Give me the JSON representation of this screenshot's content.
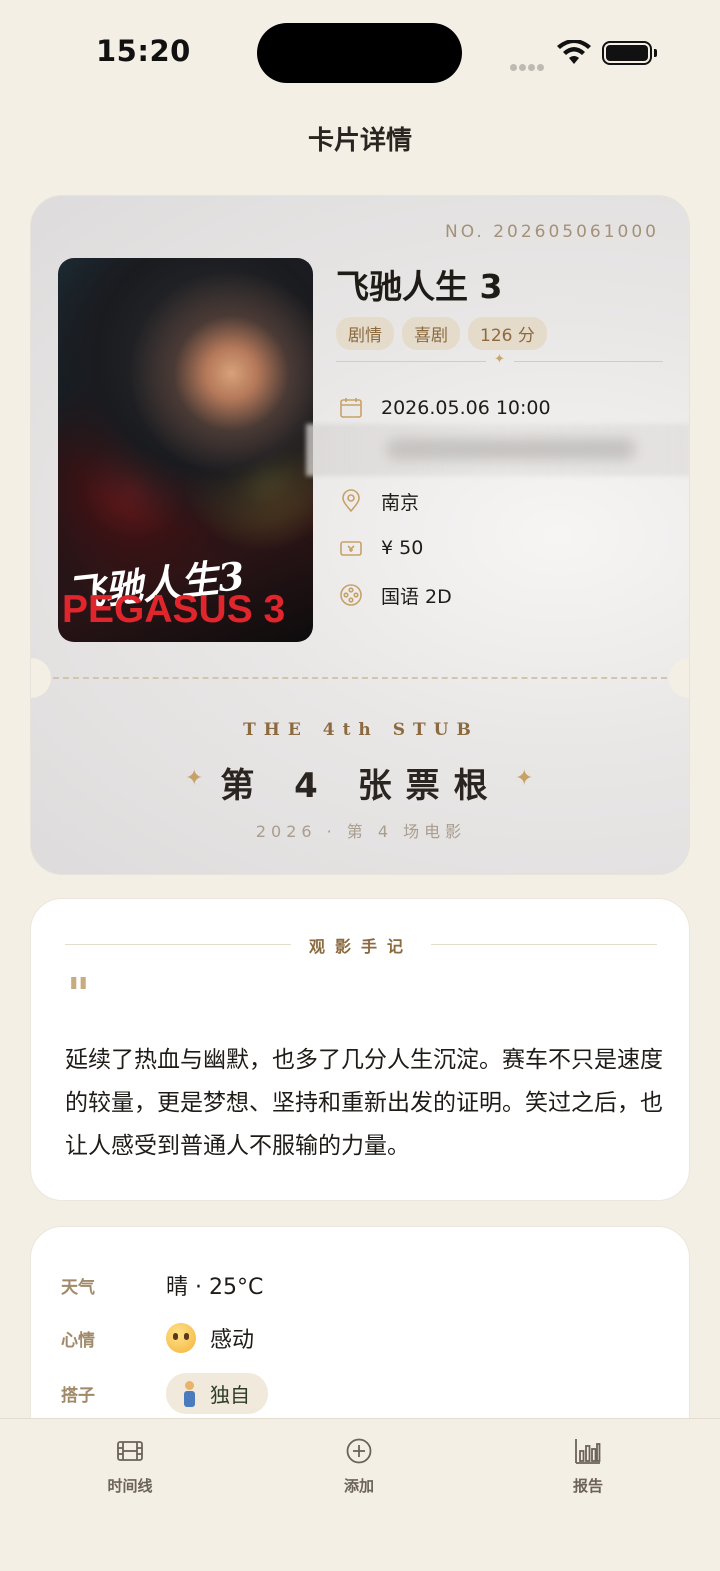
{
  "status_bar": {
    "time": "15:20"
  },
  "nav": {
    "title": "卡片详情"
  },
  "ticket": {
    "number": "NO. 202605061000",
    "poster": {
      "title_cn": "飞驰人生3",
      "title_en": "PEGASUS 3"
    },
    "movie_title": "飞驰人生 3",
    "tags": [
      "剧情",
      "喜剧",
      "126 分"
    ],
    "datetime": "2026.05.06  10:00",
    "city": "南京",
    "price": "¥ 50",
    "version": "国语 2D",
    "stub_en": "THE 4th STUB",
    "stub_title": "第 4 张票根",
    "stub_sub": "2026 · 第 4 场电影"
  },
  "note": {
    "header": "观影手记",
    "quote_mark": "\"",
    "text": "延续了热血与幽默，也多了几分人生沉淀。赛车不只是速度的较量，更是梦想、坚持和重新出发的证明。笑过之后，也让人感受到普通人不服输的力量。"
  },
  "meta": {
    "weather_label": "天气",
    "weather_value": "晴 · 25°C",
    "mood_label": "心情",
    "mood_value": "感动",
    "partner_label": "搭子",
    "partner_value": "独自"
  },
  "tab_bar": {
    "items": [
      {
        "label": "时间线",
        "icon": "film-icon"
      },
      {
        "label": "添加",
        "icon": "plus-circle-icon"
      },
      {
        "label": "报告",
        "icon": "bar-chart-icon"
      }
    ]
  },
  "colors": {
    "accent": "#c7a268",
    "background": "#f4efe4",
    "tag_bg": "#e5dbcb",
    "tag_text": "#8c6a40"
  }
}
